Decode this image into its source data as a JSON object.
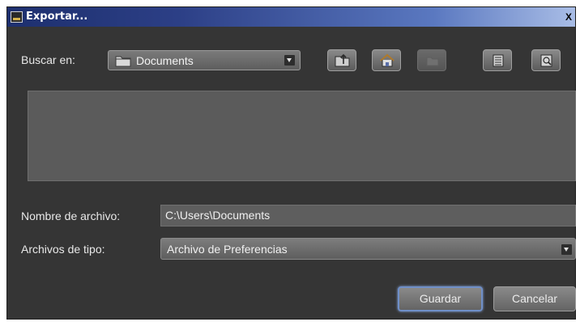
{
  "window": {
    "title": "Exportar...",
    "close_glyph": "X"
  },
  "look_in": {
    "label": "Buscar en:",
    "value": "Documents",
    "icon": "folder-icon"
  },
  "toolbar": {
    "buttons": [
      {
        "name": "up-folder-icon",
        "enabled": true
      },
      {
        "name": "home-icon",
        "enabled": true
      },
      {
        "name": "new-folder-icon",
        "enabled": false
      },
      {
        "name": "list-view-icon",
        "enabled": true
      },
      {
        "name": "details-view-icon",
        "enabled": true
      }
    ]
  },
  "file_list": {
    "items": []
  },
  "filename": {
    "label": "Nombre de archivo:",
    "value": "C:\\Users\\Documents"
  },
  "file_type": {
    "label": "Archivos de tipo:",
    "value": "Archivo de Preferencias"
  },
  "actions": {
    "save_label": "Guardar",
    "cancel_label": "Cancelar"
  },
  "colors": {
    "dialog_bg": "#353535",
    "titlebar_start": "#1d2f6e",
    "titlebar_end": "#a9bde6",
    "focus_ring": "#6f8fc8"
  }
}
